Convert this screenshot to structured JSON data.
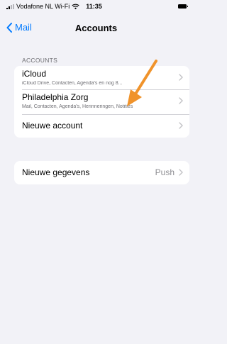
{
  "status_bar": {
    "carrier": "Vodafone NL Wi-Fi",
    "time": "11:35"
  },
  "nav": {
    "back_label": "Mail",
    "title": "Accounts"
  },
  "accounts_section": {
    "header": "ACCOUNTS",
    "items": [
      {
        "title": "iCloud",
        "subtitle": "iCloud Drive, Contacten, Agenda's en nog 8..."
      },
      {
        "title": "Philadelphia Zorg",
        "subtitle": "Mail, Contacten, Agenda's, Herinneringen, Notities"
      },
      {
        "title": "Nieuwe account"
      }
    ]
  },
  "fetch_section": {
    "title": "Nieuwe gegevens",
    "value": "Push"
  },
  "colors": {
    "accent": "#007aff",
    "background": "#f2f2f7",
    "annotation_arrow": "#f0932b"
  }
}
